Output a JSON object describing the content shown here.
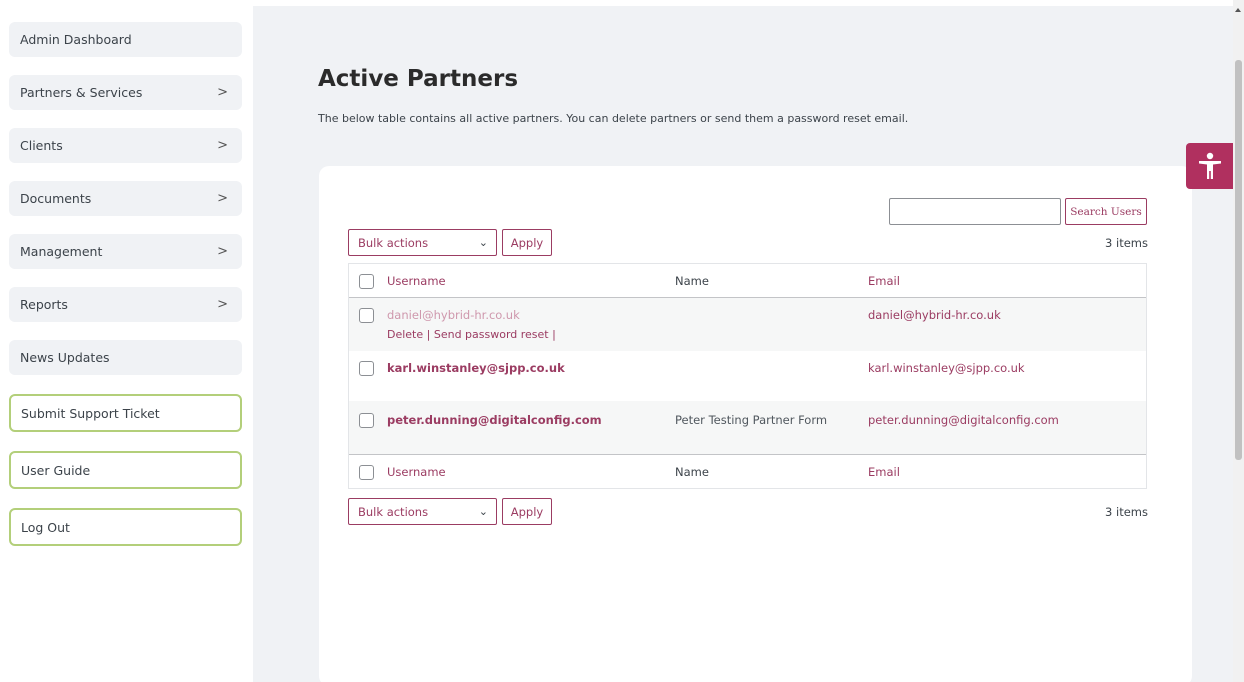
{
  "sidebar": {
    "items": [
      {
        "label": "Admin Dashboard",
        "chevron": ""
      },
      {
        "label": "Partners & Services",
        "chevron": ">"
      },
      {
        "label": "Clients",
        "chevron": ">"
      },
      {
        "label": "Documents",
        "chevron": ">"
      },
      {
        "label": "Management",
        "chevron": ">"
      },
      {
        "label": "Reports",
        "chevron": ">"
      },
      {
        "label": "News Updates",
        "chevron": ""
      }
    ],
    "actions": [
      {
        "label": "Submit Support Ticket"
      },
      {
        "label": "User Guide"
      },
      {
        "label": "Log Out"
      }
    ]
  },
  "page": {
    "title": "Active Partners",
    "description": "The below table contains all active partners. You can delete partners or send them a password reset email."
  },
  "search": {
    "value": "",
    "button_label": "Search Users"
  },
  "bulk": {
    "top_label": "Bulk actions",
    "bottom_label": "Bulk actions",
    "apply_label": "Apply",
    "items_count_top": "3 items",
    "items_count_bottom": "3 items"
  },
  "table": {
    "columns": [
      "Username",
      "Name",
      "Email"
    ],
    "rows": [
      {
        "username": "daniel@hybrid-hr.co.uk",
        "name": "",
        "email": "daniel@hybrid-hr.co.uk",
        "actions": "Delete | Send password reset |"
      },
      {
        "username": "karl.winstanley@sjpp.co.uk",
        "name": "",
        "email": "karl.winstanley@sjpp.co.uk"
      },
      {
        "username": "peter.dunning@digitalconfig.com",
        "name": "Peter Testing Partner Form",
        "email": "peter.dunning@digitalconfig.com"
      }
    ]
  },
  "colors": {
    "accent": "#9b3c62",
    "accessibility": "#b0305f",
    "sidebar_action_border": "#b3cf7a"
  },
  "icons": {
    "accessibility": "accessibility-icon",
    "chevron": "chevron-right-icon",
    "dropdown": "chevron-down-icon"
  }
}
